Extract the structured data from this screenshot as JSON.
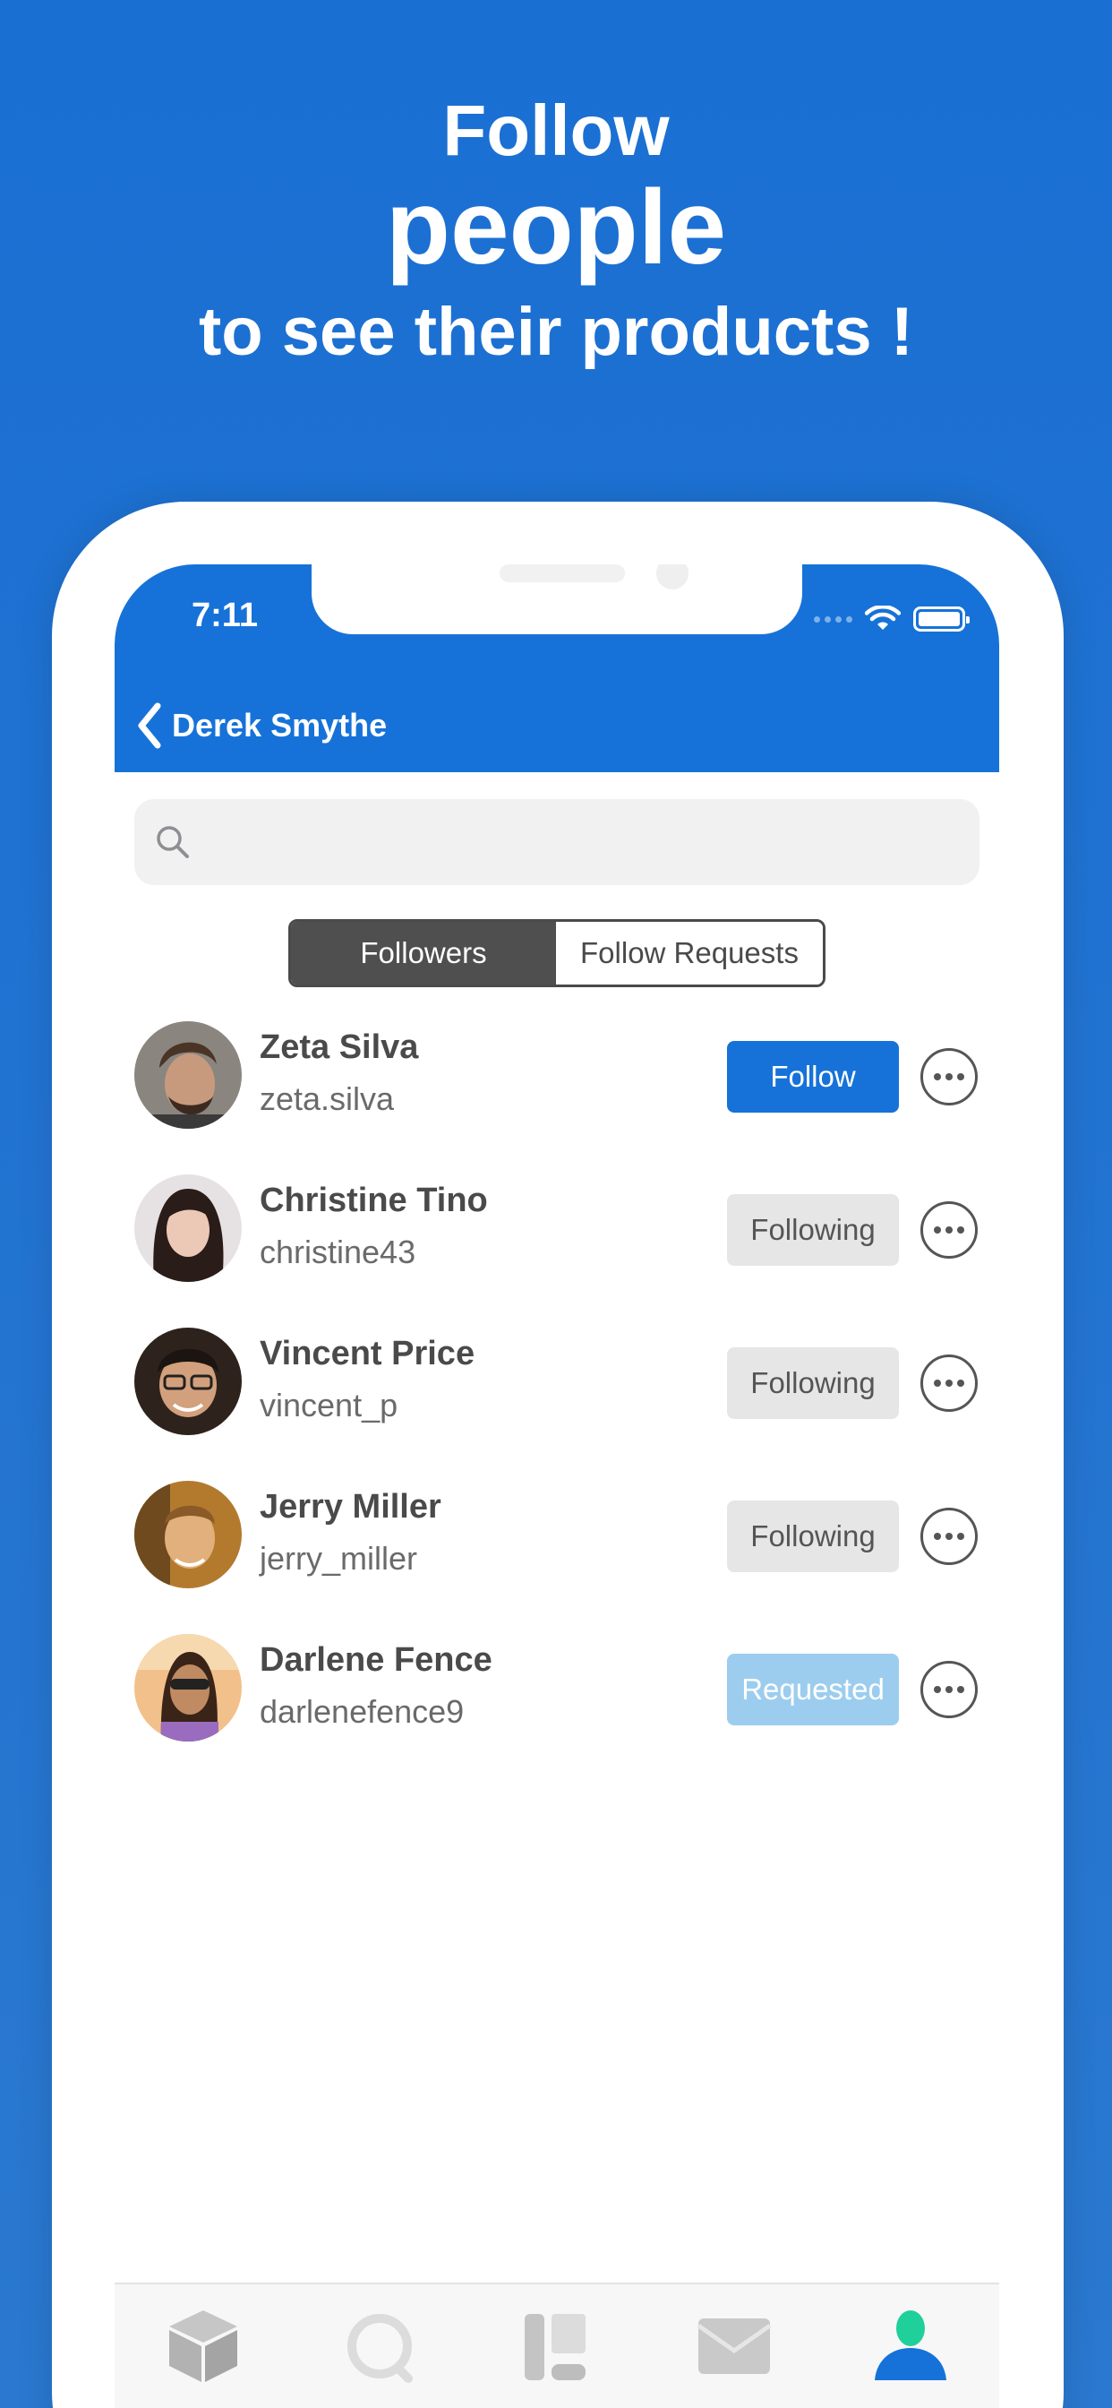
{
  "headline": {
    "line1": "Follow",
    "line2": "people",
    "line3": "to see their products !"
  },
  "status_bar": {
    "time": "7:11"
  },
  "nav": {
    "back_label": "Derek Smythe"
  },
  "search": {
    "placeholder": ""
  },
  "segments": {
    "followers": "Followers",
    "follow_requests": "Follow Requests",
    "selected": "Followers"
  },
  "people": [
    {
      "name": "Zeta Silva",
      "handle": "zeta.silva",
      "action": "Follow"
    },
    {
      "name": "Christine Tino",
      "handle": "christine43",
      "action": "Following"
    },
    {
      "name": "Vincent Price",
      "handle": "vincent_p",
      "action": "Following"
    },
    {
      "name": "Jerry Miller",
      "handle": "jerry_miller",
      "action": "Following"
    },
    {
      "name": "Darlene Fence",
      "handle": "darlenefence9",
      "action": "Requested"
    }
  ],
  "tabbar": {
    "items": [
      "products-cube-icon",
      "search-icon",
      "catalog-icon",
      "mail-icon",
      "profile-icon"
    ],
    "active": "profile-icon"
  },
  "colors": {
    "brand_blue": "#1672d8",
    "following_bg": "#e6e6e6",
    "requested_bg": "#9ccdee",
    "profile_head": "#1fd09b"
  }
}
